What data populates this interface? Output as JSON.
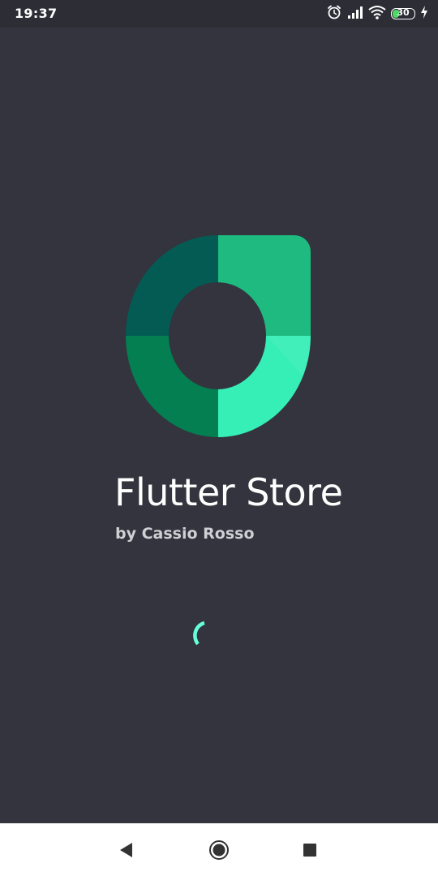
{
  "status_bar": {
    "time": "19:37",
    "battery_level": "30",
    "battery_fraction": 0.3,
    "icons": [
      "alarm-icon",
      "signal-icon",
      "wifi-icon",
      "battery-icon",
      "charging-icon"
    ]
  },
  "splash": {
    "title": "Flutter Store",
    "subtitle": "by Cassio Rosso",
    "logo_colors": [
      "#035b54",
      "#1eba80",
      "#037f52",
      "#36efb7"
    ],
    "accent_color": "#64ffda"
  },
  "nav_bar": {
    "buttons": [
      "back-icon",
      "home-icon",
      "recents-icon"
    ]
  },
  "colors": {
    "background": "#33343d",
    "status_bar": "#2c2d35",
    "nav_bar": "#ffffff"
  }
}
